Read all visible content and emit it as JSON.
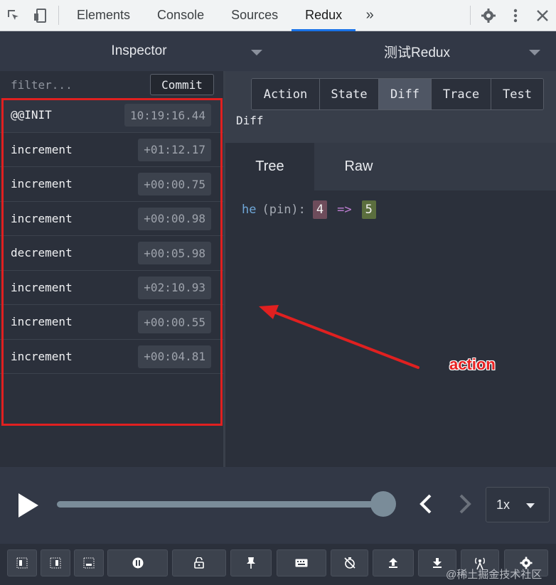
{
  "devtools": {
    "tabs": [
      "Elements",
      "Console",
      "Sources",
      "Redux"
    ],
    "active_tab": "Redux",
    "more_label": "»",
    "icons": [
      "inspect-icon",
      "device-toggle-icon",
      "gear-icon",
      "kebab-menu-icon",
      "close-icon"
    ]
  },
  "redux": {
    "left_header": "Inspector",
    "right_header": "测试Redux"
  },
  "log": {
    "filter_placeholder": "filter...",
    "commit_label": "Commit",
    "actions": [
      {
        "name": "@@INIT",
        "time": "10:19:16.44"
      },
      {
        "name": "increment",
        "time": "+01:12.17"
      },
      {
        "name": "increment",
        "time": "+00:00.75"
      },
      {
        "name": "increment",
        "time": "+00:00.98"
      },
      {
        "name": "decrement",
        "time": "+00:05.98"
      },
      {
        "name": "increment",
        "time": "+02:10.93"
      },
      {
        "name": "increment",
        "time": "+00:00.55"
      },
      {
        "name": "increment",
        "time": "+00:04.81"
      }
    ]
  },
  "monitor": {
    "segments": [
      "Action",
      "State",
      "Diff",
      "Trace",
      "Test"
    ],
    "active_segment": "Diff",
    "title": "Diff",
    "view_tabs": [
      "Tree",
      "Raw"
    ],
    "active_view": "Tree",
    "diff": {
      "key": "he",
      "path": "(pin):",
      "old": "4",
      "arrow": "=>",
      "new": "5"
    }
  },
  "annotation": {
    "label": "action",
    "color": "#e82020"
  },
  "slider": {
    "speed": "1x",
    "position_fraction": 1.0
  },
  "toolbar": {
    "buttons": [
      "dock-left-icon",
      "dock-right-icon",
      "dock-bottom-icon",
      "pause-icon",
      "lock-icon",
      "pin-icon",
      "keyboard-icon",
      "timer-off-icon",
      "upload-icon",
      "download-icon",
      "remote-icon",
      "settings-icon"
    ]
  },
  "watermark": "@稀土掘金技术社区",
  "colors": {
    "accent": "#1a73e8",
    "highlight": "#e02020",
    "diff_old": "#6e4c5b",
    "diff_new": "#5b6e3e"
  }
}
